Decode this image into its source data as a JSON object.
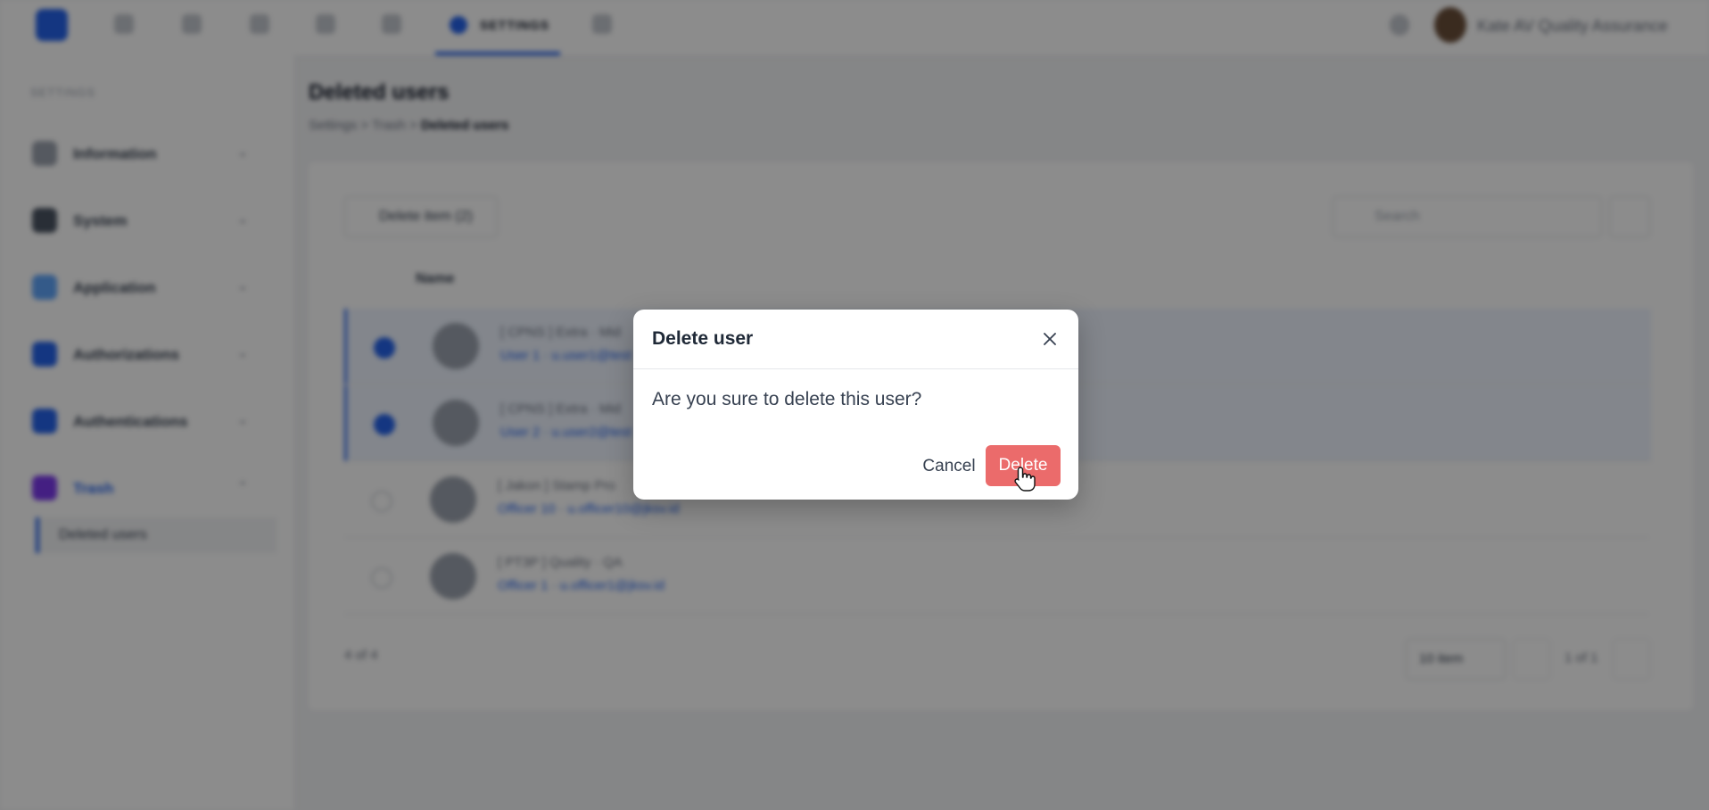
{
  "topbar": {
    "active_tab": "SETTINGS",
    "user_name": "Kate AV Quality Assurance"
  },
  "sidebar": {
    "heading": "SETTINGS",
    "items": [
      {
        "label": "Information",
        "icon": "info-icon"
      },
      {
        "label": "System",
        "icon": "system-icon"
      },
      {
        "label": "Application",
        "icon": "application-icon"
      },
      {
        "label": "Authorizations",
        "icon": "shield-icon"
      },
      {
        "label": "Authentications",
        "icon": "shield-icon"
      },
      {
        "label": "Trash",
        "icon": "trash-icon"
      }
    ],
    "sub_item": "Deleted users"
  },
  "main": {
    "title": "Deleted users",
    "breadcrumb": [
      "Settings",
      "Trash",
      "Deleted users"
    ],
    "delete_item_label": "Delete item (2)",
    "search_placeholder": "Search",
    "column_name": "Name",
    "rows": [
      {
        "org": "[ CPNS ] Extra · Mid",
        "name": "User 1 · u.user1@test",
        "selected": true
      },
      {
        "org": "[ CPNS ] Extra · Mid",
        "name": "User 2 · u.user2@test",
        "selected": true
      },
      {
        "org": "[ Jakon ] Stamp Pro",
        "name": "Officer 10 · u.officer10@jksv.id",
        "selected": false
      },
      {
        "org": "[ PT3P ] Quality · QA",
        "name": "Officer 1 · u.officer1@jksv.id",
        "selected": false
      }
    ],
    "count_label": "4 of 4",
    "page_size": "10 item",
    "page_info": "1 of 1"
  },
  "modal": {
    "title": "Delete user",
    "message": "Are you sure to delete this user?",
    "cancel_label": "Cancel",
    "delete_label": "Delete",
    "accent": "#eb6b6b"
  }
}
